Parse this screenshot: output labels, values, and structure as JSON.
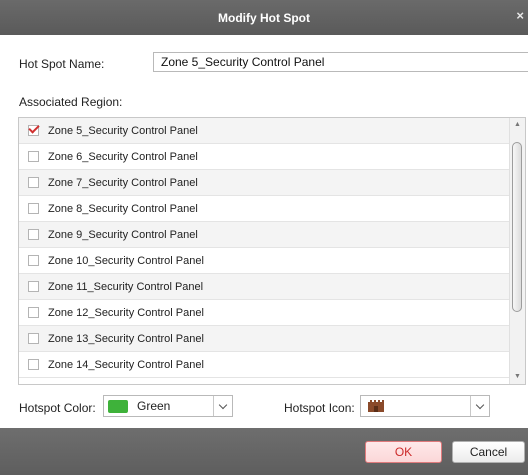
{
  "dialog": {
    "title": "Modify Hot Spot",
    "close_glyph": "×"
  },
  "hotspot_name": {
    "label": "Hot Spot Name:",
    "value": "Zone 5_Security Control Panel"
  },
  "associated_region": {
    "label": "Associated Region:",
    "items": [
      {
        "label": "Zone 5_Security Control Panel",
        "checked": true
      },
      {
        "label": "Zone 6_Security Control Panel",
        "checked": false
      },
      {
        "label": "Zone 7_Security Control Panel",
        "checked": false
      },
      {
        "label": "Zone 8_Security Control Panel",
        "checked": false
      },
      {
        "label": "Zone 9_Security Control Panel",
        "checked": false
      },
      {
        "label": "Zone 10_Security Control Panel",
        "checked": false
      },
      {
        "label": "Zone 11_Security Control Panel",
        "checked": false
      },
      {
        "label": "Zone 12_Security Control Panel",
        "checked": false
      },
      {
        "label": "Zone 13_Security Control Panel",
        "checked": false
      },
      {
        "label": "Zone 14_Security Control Panel",
        "checked": false
      }
    ]
  },
  "hotspot_color": {
    "label": "Hotspot Color:",
    "selected": "Green",
    "swatch_color": "#3eb23a"
  },
  "hotspot_icon": {
    "label": "Hotspot Icon:",
    "selected_icon": "castle-icon",
    "icon_color": "#8a4a2a"
  },
  "buttons": {
    "ok": "OK",
    "cancel": "Cancel"
  },
  "colors": {
    "titlebar": "#5f5f5f",
    "check_mark": "#d0302f",
    "ok_text": "#cc2a2a"
  }
}
